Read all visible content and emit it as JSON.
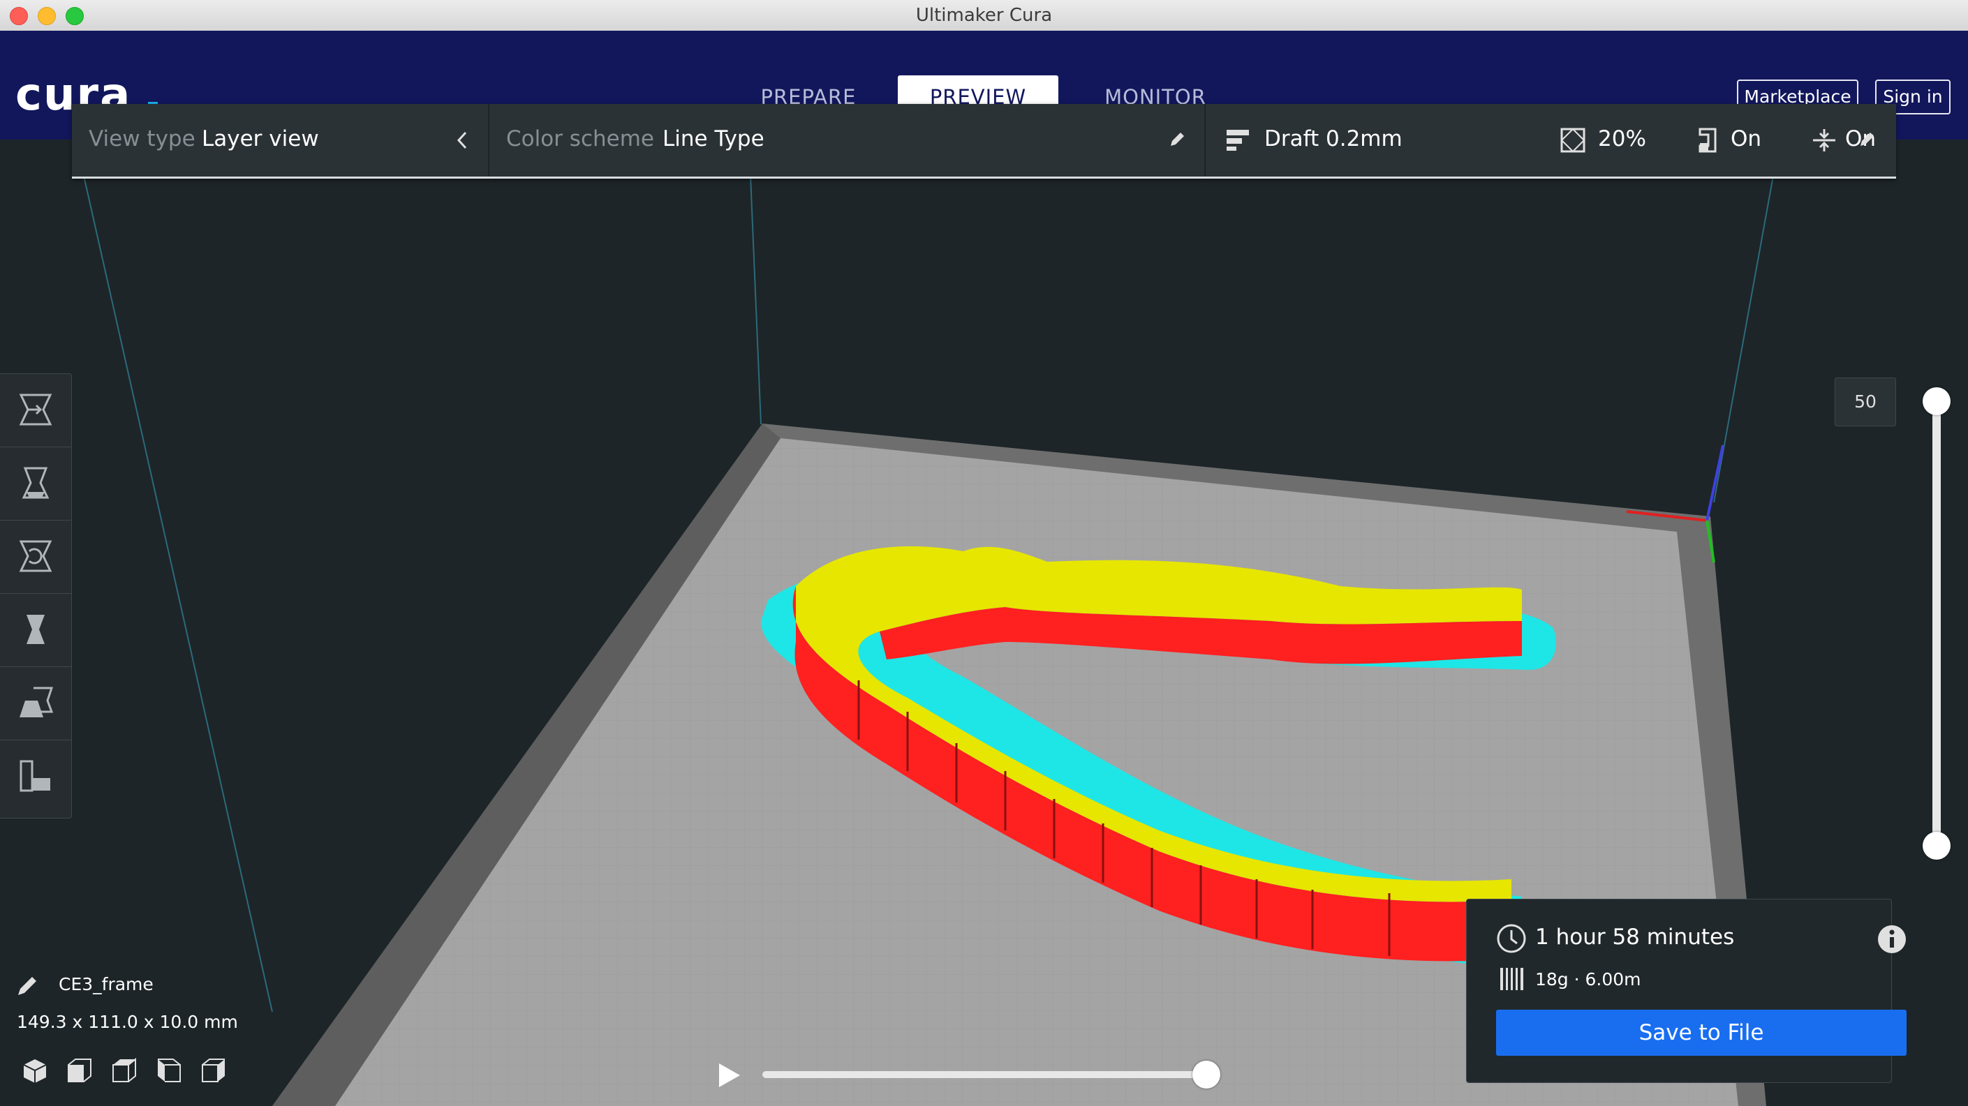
{
  "window": {
    "title": "Ultimaker Cura"
  },
  "header": {
    "logo_text": "cura.",
    "tabs": [
      {
        "label": "PREPARE",
        "active": false
      },
      {
        "label": "PREVIEW",
        "active": true
      },
      {
        "label": "MONITOR",
        "active": false
      }
    ],
    "marketplace_label": "Marketplace",
    "signin_label": "Sign in"
  },
  "stage_menu": {
    "view_type_label": "View type",
    "view_type_value": "Layer view",
    "color_scheme_label": "Color scheme",
    "color_scheme_value": "Line Type",
    "profile": "Draft 0.2mm",
    "infill": "20%",
    "support": "On",
    "adhesion": "On"
  },
  "toolbar": {
    "tools": [
      "move-tool-icon",
      "scale-tool-icon",
      "rotate-tool-icon",
      "mirror-tool-icon",
      "per-model-settings-icon",
      "support-blocker-icon"
    ]
  },
  "layer_slider": {
    "current_layer": "50"
  },
  "object": {
    "name": "CE3_frame",
    "dimensions": "149.3 x 111.0 x 10.0 mm"
  },
  "camera_views": [
    "3d-view-icon",
    "front-view-icon",
    "top-view-icon",
    "left-view-icon",
    "right-view-icon"
  ],
  "print_panel": {
    "time": "1 hour 58 minutes",
    "material": "18g · 6.00m",
    "save_label": "Save to File"
  },
  "colors": {
    "header": "#12175c",
    "accent": "#196ef0",
    "wall_outer": "#ff2020",
    "wall_inner": "#e6e600",
    "skirt": "#19e6e6",
    "plate": "#a4a4a4"
  }
}
